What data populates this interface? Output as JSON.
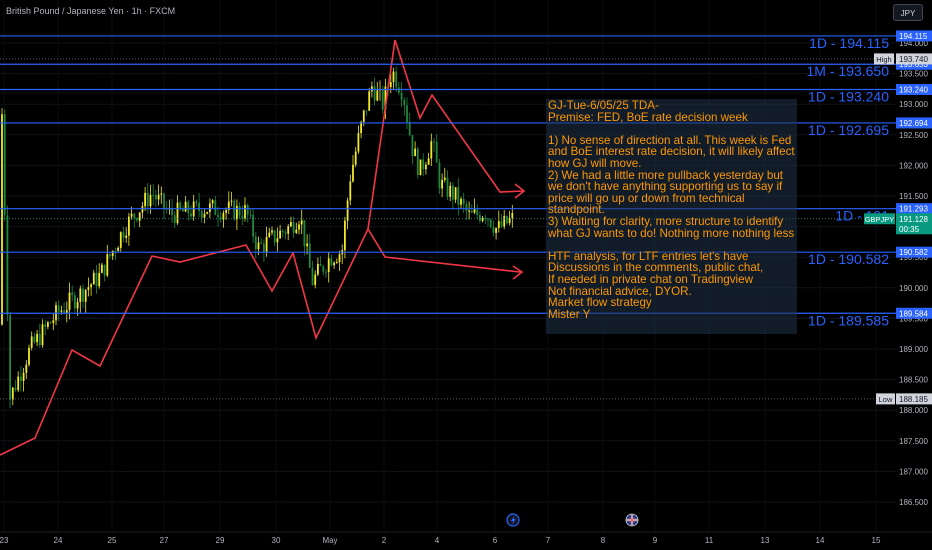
{
  "header": {
    "symbol_title": "British Pound / Japanese Yen · 1h · FXCM",
    "currency_button": "JPY"
  },
  "annotation_note": {
    "text": "GJ-Tue-6/05/25 TDA-\nPremise: FED, BoE rate decision week\n\n1) No sense of direction at all. This week is Fed and BoE interest rate decision, it will likely affect how GJ will move.\n2) We had a little more pullback yesterday but we don't have anything supporting us to say if price will go up or down from technical standpoint.\n3) Waiting for clarity, more structure to identify what GJ wants to do! Nothing more nothing less\n\nHTF analysis, for LTF entries let's have\nDiscussions in the comments, public chat,\nIf needed in private chat on Tradingview\nNot financial advice, DYOR.\nMarket flow strategy\nMister Y",
    "text_color": "#ff9800"
  },
  "colors": {
    "background": "#000000",
    "level_line": "#2962ff",
    "level_label": "#2962ff",
    "candle_up": "#f2e82c",
    "candle_down": "#1e8a3e",
    "trend_line": "#f23645",
    "axis_text": "#b2b5be"
  },
  "price_axis": {
    "ticks": [
      "194.000",
      "193.500",
      "193.000",
      "192.500",
      "192.000",
      "191.500",
      "191.000",
      "190.500",
      "190.000",
      "189.500",
      "189.000",
      "188.500",
      "188.000",
      "187.500",
      "187.000",
      "186.500"
    ],
    "current_symbol": "GBPJPY",
    "current_price": "191.128",
    "countdown": "00:35",
    "high_label": "High",
    "high_price": "193.740",
    "low_label": "Low",
    "low_price": "188.185"
  },
  "time_axis": {
    "ticks": [
      "23",
      "24",
      "25",
      "27",
      "29",
      "30",
      "May",
      "2",
      "4",
      "6",
      "7",
      "8",
      "9",
      "11",
      "13",
      "14",
      "15"
    ],
    "event_icons": [
      "lightning-icon",
      "uk-flag-icon"
    ]
  },
  "levels": [
    {
      "label": "1D - 194.115",
      "tag": "194.115",
      "price": 194.115
    },
    {
      "label": "1M - 193.650",
      "tag": "193.653",
      "price": 193.653
    },
    {
      "label": "1D - 193.240",
      "tag": "193.240",
      "price": 193.24
    },
    {
      "label": "1D - 192.695",
      "tag": "192.694",
      "price": 192.694
    },
    {
      "label": "1D - 191",
      "tag": "191.293",
      "price": 191.293
    },
    {
      "label": "1D - 190.582",
      "tag": "190.582",
      "price": 190.582
    },
    {
      "label": "1D - 189.585",
      "tag": "189.584",
      "price": 189.584
    }
  ],
  "chart_data": {
    "type": "candlestick",
    "symbol": "British Pound / Japanese Yen",
    "interval": "1h",
    "source": "FXCM",
    "ylim": [
      186.45,
      194.6
    ],
    "x_tick_labels": [
      "23",
      "24",
      "25",
      "27",
      "29",
      "30",
      "May",
      "2",
      "4",
      "6",
      "7",
      "8",
      "9",
      "11",
      "13",
      "14",
      "15"
    ],
    "high": 193.74,
    "low": 188.185,
    "last": 191.128,
    "price_path_anchors": [
      {
        "t": "23",
        "price": 189.6
      },
      {
        "t": "23",
        "price": 188.3
      },
      {
        "t": "24",
        "price": 189.9
      },
      {
        "t": "25",
        "price": 190.5
      },
      {
        "t": "25",
        "price": 191.6
      },
      {
        "t": "27",
        "price": 191.2
      },
      {
        "t": "29",
        "price": 191.4
      },
      {
        "t": "29",
        "price": 190.6
      },
      {
        "t": "30",
        "price": 191.1
      },
      {
        "t": "30",
        "price": 190.2
      },
      {
        "t": "May",
        "price": 190.6
      },
      {
        "t": "May",
        "price": 191.3
      },
      {
        "t": "2",
        "price": 193.2
      },
      {
        "t": "2",
        "price": 193.7
      },
      {
        "t": "2",
        "price": 193.2
      },
      {
        "t": "4",
        "price": 192.2
      },
      {
        "t": "4",
        "price": 192.6
      },
      {
        "t": "4",
        "price": 191.6
      },
      {
        "t": "6",
        "price": 191.3
      },
      {
        "t": "6",
        "price": 191.0
      },
      {
        "t": "6",
        "price": 191.13
      }
    ]
  }
}
